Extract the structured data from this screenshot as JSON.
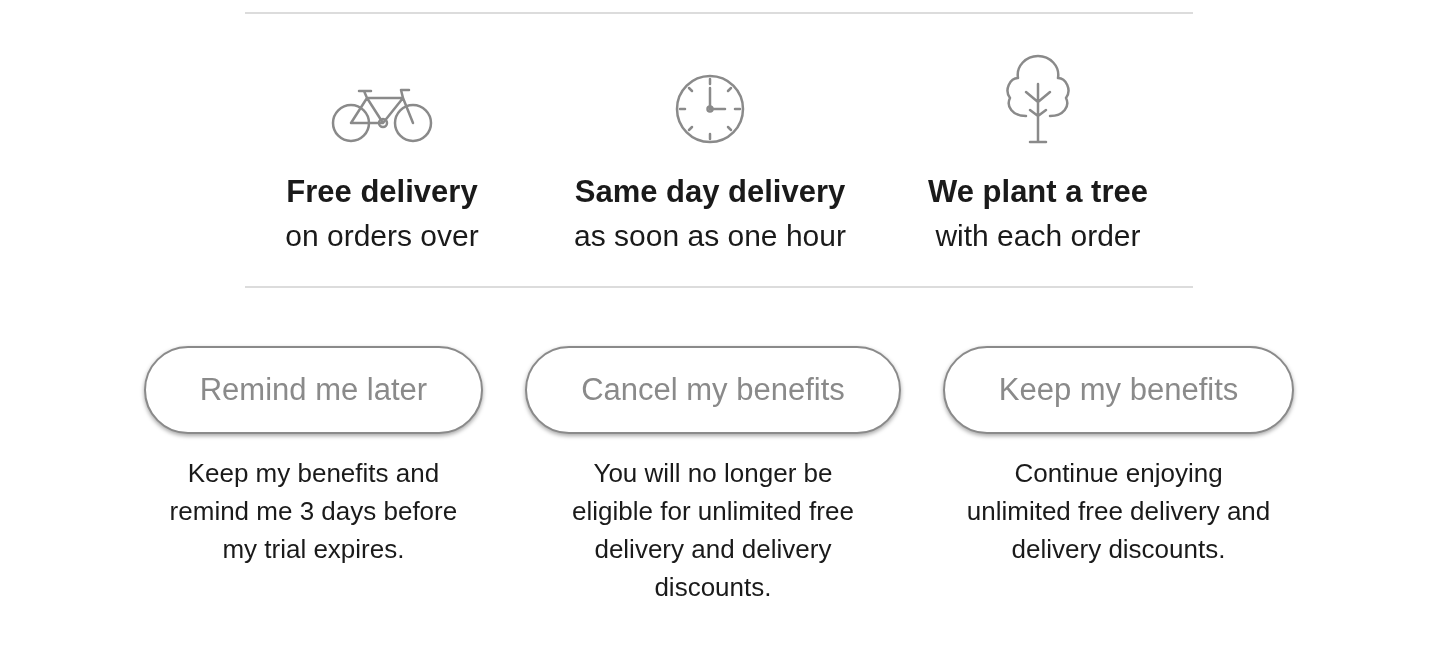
{
  "features": [
    {
      "kind": "bicycle",
      "title": "Free delivery",
      "subtitle": "on orders over"
    },
    {
      "kind": "clock",
      "title": "Same day delivery",
      "subtitle": "as soon as one hour"
    },
    {
      "kind": "tree",
      "title": "We plant a tree",
      "subtitle": "with each order"
    }
  ],
  "actions": [
    {
      "label": "Remind me later",
      "description": "Keep my benefits and remind me 3 days before my trial expires."
    },
    {
      "label": "Cancel my benefits",
      "description": "You will no longer be eligible for unlimited free delivery and delivery discounts."
    },
    {
      "label": "Keep my benefits",
      "description": "Continue enjoying unlimited free delivery and delivery discounts."
    }
  ]
}
